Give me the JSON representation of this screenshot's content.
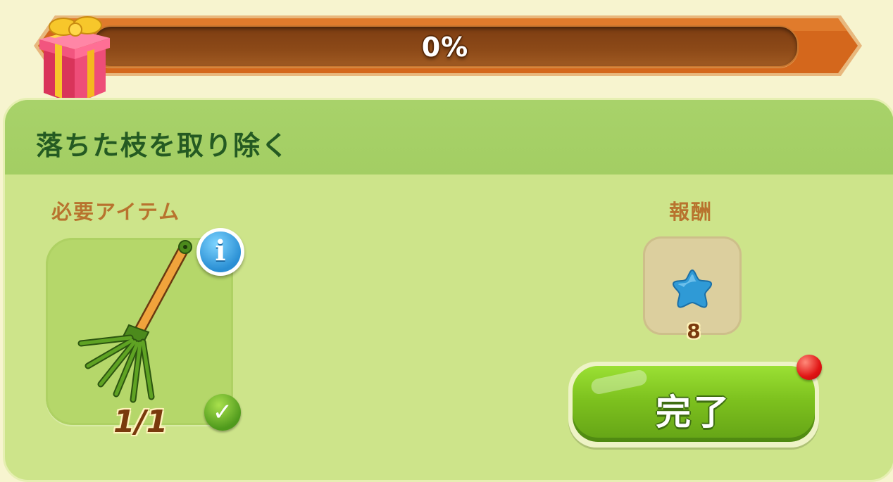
{
  "progress": {
    "percent_text": "0%",
    "fraction": 0.0
  },
  "gift": {
    "icon": "gift-box-icon"
  },
  "task": {
    "title": "落ちた枝を取り除く",
    "required_label": "必要アイテム",
    "required_item": {
      "icon": "rake-icon",
      "count": "1/1",
      "completed": true
    },
    "reward_label": "報酬",
    "reward": {
      "icon": "blue-star-icon",
      "amount": "8"
    },
    "done_button_label": "完了",
    "notification": true
  },
  "colors": {
    "banner": "#d46a1f",
    "card": "#cde48a",
    "card_header": "#a8d26a",
    "title_text": "#245a22",
    "label_text": "#b8732e",
    "button_green": "#7dc11e",
    "notification_red": "#e01414",
    "star_blue": "#2f9ad6"
  }
}
